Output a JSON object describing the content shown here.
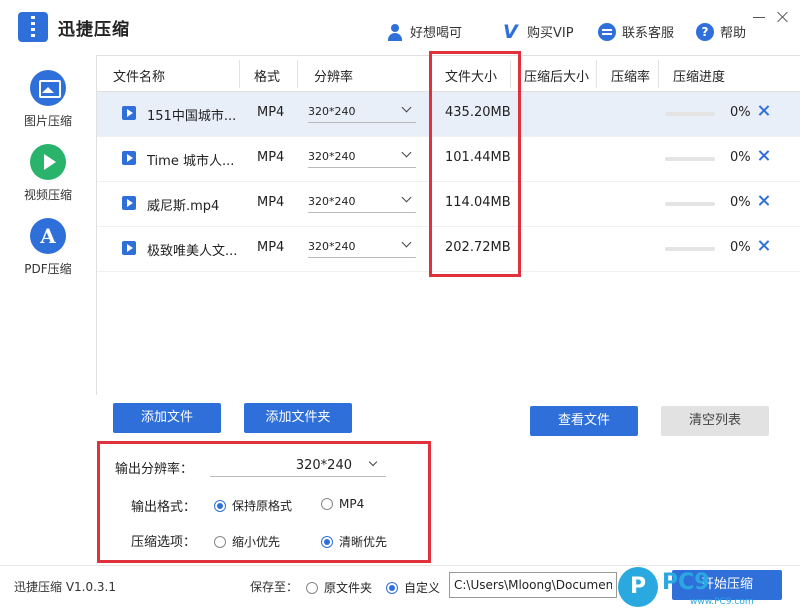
{
  "app": {
    "title": "迅捷压缩",
    "version": "迅捷压缩 V1.0.3.1"
  },
  "topbar": {
    "user_label": "好想喝可",
    "vip_label": "购买VIP",
    "service_label": "联系客服",
    "help_label": "帮助"
  },
  "sidebar": {
    "items": [
      {
        "label": "图片压缩",
        "icon": "image-icon"
      },
      {
        "label": "视频压缩",
        "icon": "play-icon",
        "active": true
      },
      {
        "label": "PDF压缩",
        "icon": "pdf-icon"
      }
    ]
  },
  "table": {
    "headers": [
      "文件名称",
      "格式",
      "分辨率",
      "文件大小",
      "压缩后大小",
      "压缩率",
      "压缩进度"
    ],
    "rows": [
      {
        "name": "151中国城市...",
        "format": "MP4",
        "resolution": "320*240",
        "size": "435.20MB",
        "compressed_size": "",
        "ratio": "",
        "progress": "0%",
        "progress_value": 0
      },
      {
        "name": "Time 城市人...",
        "format": "MP4",
        "resolution": "320*240",
        "size": "101.44MB",
        "compressed_size": "",
        "ratio": "",
        "progress": "0%",
        "progress_value": 0
      },
      {
        "name": "威尼斯.mp4",
        "format": "MP4",
        "resolution": "320*240",
        "size": "114.04MB",
        "compressed_size": "",
        "ratio": "",
        "progress": "0%",
        "progress_value": 0
      },
      {
        "name": "极致唯美人文...",
        "format": "MP4",
        "resolution": "320*240",
        "size": "202.72MB",
        "compressed_size": "",
        "ratio": "",
        "progress": "0%",
        "progress_value": 0
      }
    ]
  },
  "actions": {
    "add_file": "添加文件",
    "add_folder": "添加文件夹",
    "view_files": "查看文件",
    "clear_list": "清空列表"
  },
  "options": {
    "resolution_label": "输出分辨率：",
    "resolution_value": "320*240",
    "format_label": "输出格式：",
    "format_keep": "保持原格式",
    "format_mp4": "MP4",
    "compress_label": "压缩选项：",
    "compress_small": "缩小优先",
    "compress_clear": "清晰优先"
  },
  "footer": {
    "save_to": "保存至：",
    "original_folder": "原文件夹",
    "custom": "自定义",
    "path_value": "C:\\Users\\Mloong\\Documents",
    "start_label": "开始压缩"
  },
  "watermark": {
    "logo_letter": "P",
    "text": "PC9",
    "sub": "www.PC9.com"
  },
  "colors": {
    "accent": "#2e6fd9",
    "active": "#2ab36b",
    "highlight": "#e0323c"
  }
}
